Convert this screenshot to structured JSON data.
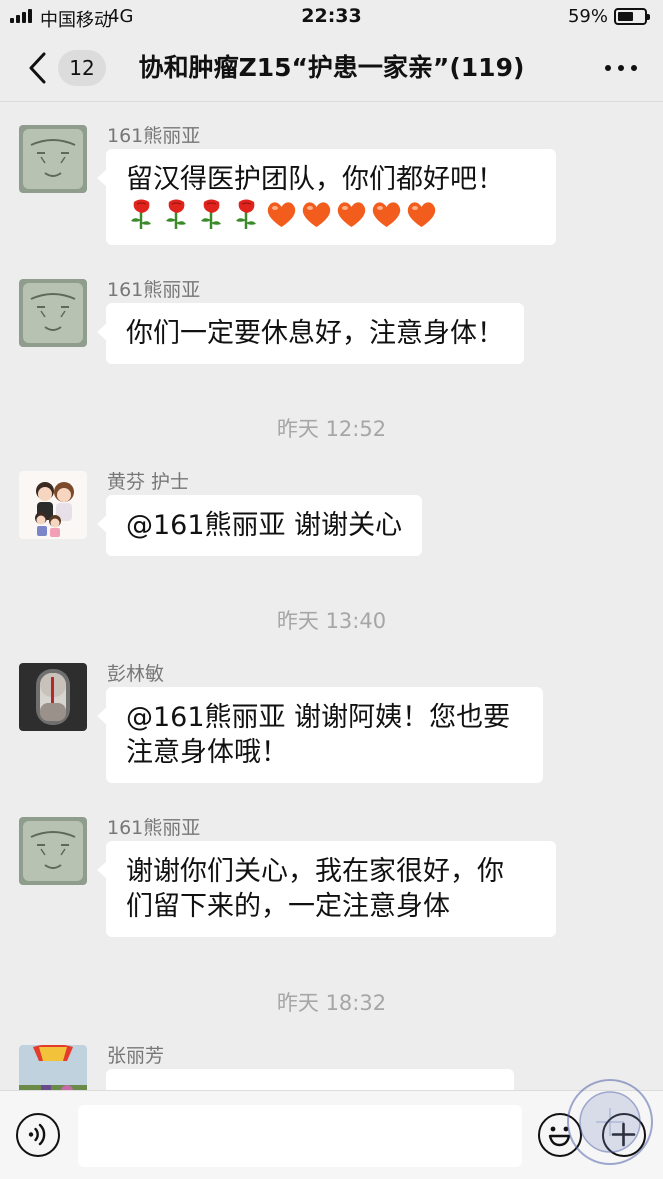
{
  "status_bar": {
    "carrier": "中国移动",
    "network": "4G",
    "time": "22:33",
    "battery_percent": "59%",
    "battery_level": 0.59
  },
  "nav": {
    "unread_count": "12",
    "title": "协和肿瘤Z15“护患一家亲”(119)"
  },
  "messages": [
    {
      "sender": "161熊丽亚",
      "text": "留汉得医护团队，你们都好吧！",
      "emoji": [
        "rose-emoji",
        "rose-emoji",
        "rose-emoji",
        "rose-emoji",
        "heart-emoji",
        "heart-emoji",
        "heart-emoji",
        "heart-emoji",
        "heart-emoji"
      ]
    },
    {
      "sender": "161熊丽亚",
      "text": "你们一定要休息好，注意身体！"
    },
    {
      "time": "昨天 12:52"
    },
    {
      "sender": "黄芬 护士",
      "text": "@161熊丽亚 谢谢关心"
    },
    {
      "time": "昨天 13:40"
    },
    {
      "sender": "彭林敏",
      "text_lines": [
        "@161熊丽亚 谢谢阿姨！您也要",
        "注意身体哦！"
      ]
    },
    {
      "sender": "161熊丽亚",
      "text_lines": [
        "谢谢你们关心，我在家很好，你",
        "们留下来的，一定注意身体"
      ]
    },
    {
      "time": "昨天 18:32"
    },
    {
      "sender": "张丽芳"
    }
  ],
  "input": {
    "value": ""
  },
  "colors": {
    "background": "#ededed",
    "bubble": "#ffffff",
    "timestamp": "#a6a6a6",
    "sender_name": "#777777",
    "rose": "#e0231c",
    "heart": "#f25c1c"
  }
}
